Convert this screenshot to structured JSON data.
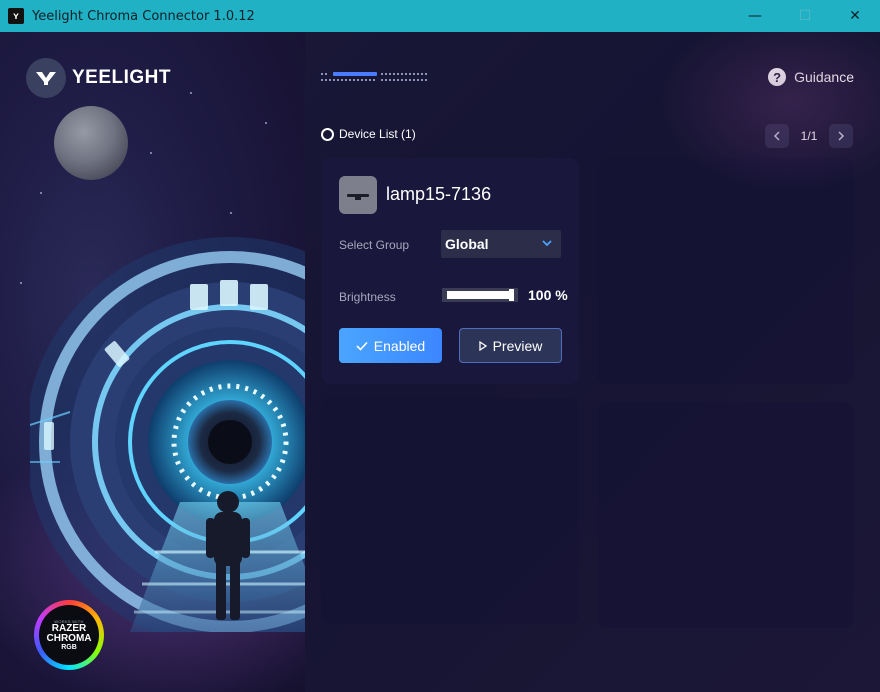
{
  "window": {
    "title": "Yeelight Chroma Connector 1.0.12",
    "app_icon": "yeelight-app-icon",
    "controls": {
      "minimize": "—",
      "maximize": "☐",
      "close": "✕"
    }
  },
  "brand": {
    "logo_text": "YEELIGHT",
    "badge_lines": [
      "WORKS WITH",
      "RAZER",
      "CHROMA",
      "RGB"
    ]
  },
  "header": {
    "guidance_label": "Guidance",
    "guidance_icon": "help-icon"
  },
  "device_list": {
    "label": "Device List (1)",
    "pager": {
      "text": "1/1",
      "prev": "‹",
      "next": "›"
    }
  },
  "devices": [
    {
      "name": "lamp15-7136",
      "icon": "light-bar-icon",
      "group_label": "Select Group",
      "group_value": "Global",
      "brightness_label": "Brightness",
      "brightness_value": "100 %",
      "brightness_fraction": 1.0,
      "enabled_label": "Enabled",
      "preview_label": "Preview"
    }
  ],
  "colors": {
    "titlebar": "#20b2c4",
    "accent": "#4aa5ff",
    "background": "#171534"
  }
}
